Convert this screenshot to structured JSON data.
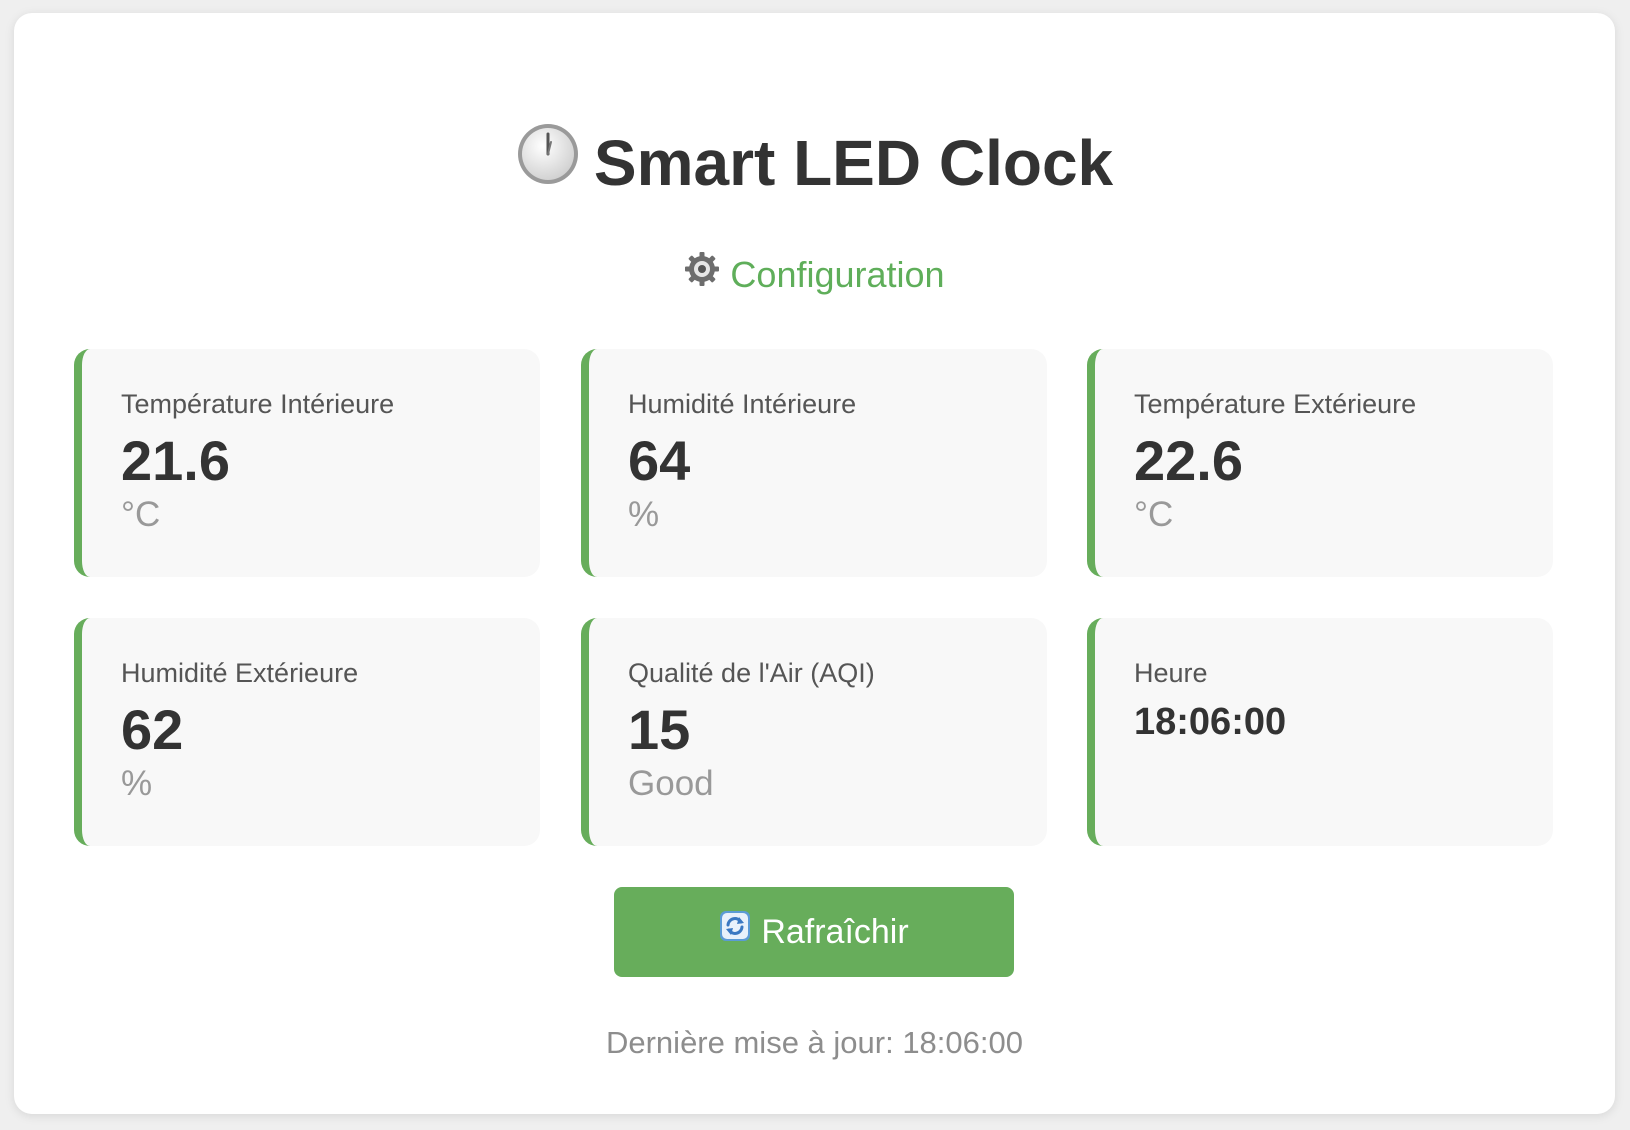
{
  "header": {
    "title": "Smart LED Clock",
    "title_icon": "clock-icon"
  },
  "config_link": {
    "label": "Configuration",
    "icon": "gear-icon"
  },
  "tiles": [
    {
      "label": "Température Intérieure",
      "value": "21.6",
      "unit": "°C"
    },
    {
      "label": "Humidité Intérieure",
      "value": "64",
      "unit": "%"
    },
    {
      "label": "Température Extérieure",
      "value": "22.6",
      "unit": "°C"
    },
    {
      "label": "Humidité Extérieure",
      "value": "62",
      "unit": "%"
    },
    {
      "label": "Qualité de l'Air (AQI)",
      "value": "15",
      "unit": "Good"
    },
    {
      "label": "Heure",
      "value": "18:06:00"
    }
  ],
  "refresh_button": {
    "label": "Rafraîchir",
    "icon": "refresh-icon"
  },
  "footer": {
    "last_update": "Dernière mise à jour: 18:06:00"
  },
  "colors": {
    "accent": "#67ad5b",
    "link": "#5fae5a",
    "text": "#333333",
    "tile_bg": "#f8f8f8"
  }
}
